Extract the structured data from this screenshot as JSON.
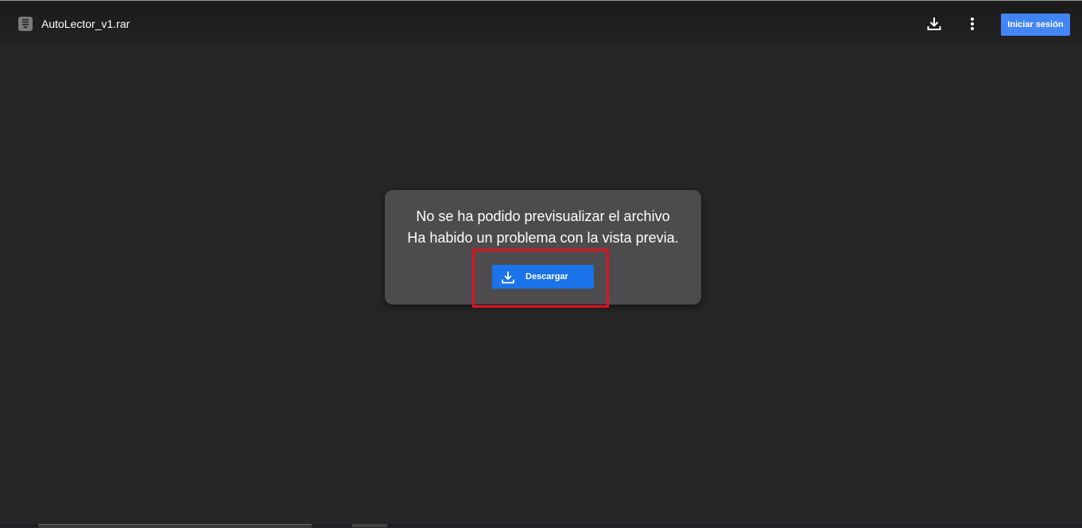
{
  "header": {
    "file_name": "AutoLector_v1.rar",
    "file_icon": "archive-file-icon",
    "download_icon": "download-icon",
    "more_icon": "more-vert-icon",
    "signin_label": "Iniciar sesión"
  },
  "preview_error": {
    "line1": "No se ha podido previsualizar el archivo",
    "line2": "Ha habido un problema con la vista previa.",
    "download_label": "Descargar",
    "download_icon": "download-icon"
  },
  "colors": {
    "background": "#262626",
    "card": "#4d4b4d",
    "accent_blue": "#1a73e8",
    "signin_blue": "#4285f4",
    "highlight_red": "#e3101e"
  }
}
